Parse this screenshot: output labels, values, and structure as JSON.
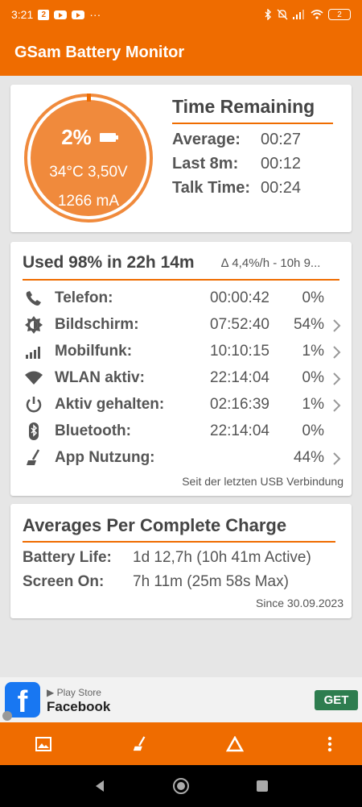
{
  "status_bar": {
    "time": "3:21",
    "notif_badge": "2",
    "more": "···",
    "battery": "2"
  },
  "app": {
    "title": "GSam Battery Monitor"
  },
  "gauge": {
    "percent": "2%",
    "temp_volt": "34°C  3,50V",
    "current": "1266 mA",
    "level": 0.02
  },
  "time_remaining": {
    "title": "Time Remaining",
    "rows": [
      {
        "label": "Average:",
        "value": "00:27"
      },
      {
        "label": "Last 8m:",
        "value": "00:12"
      },
      {
        "label": "Talk Time:",
        "value": "00:24"
      }
    ]
  },
  "usage": {
    "title": "Used 98% in 22h 14m",
    "rate": "∆ 4,4%/h - 10h 9...",
    "rows": [
      {
        "label": "Telefon:",
        "time": "00:00:42",
        "pct": "0%",
        "icon": "phone-icon"
      },
      {
        "label": "Bildschirm:",
        "time": "07:52:40",
        "pct": "54%",
        "icon": "brightness-icon"
      },
      {
        "label": "Mobilfunk:",
        "time": "10:10:15",
        "pct": "1%",
        "icon": "signal-icon"
      },
      {
        "label": "WLAN aktiv:",
        "time": "22:14:04",
        "pct": "0%",
        "icon": "wifi-icon"
      },
      {
        "label": "Aktiv gehalten:",
        "time": "02:16:39",
        "pct": "1%",
        "icon": "power-icon"
      },
      {
        "label": "Bluetooth:",
        "time": "22:14:04",
        "pct": "0%",
        "icon": "bluetooth-icon"
      },
      {
        "label": "App Nutzung:",
        "time": "",
        "pct": "44%",
        "icon": "broom-icon"
      }
    ],
    "footer": "Seit der letzten USB Verbindung"
  },
  "averages": {
    "title": "Averages Per Complete Charge",
    "rows": [
      {
        "label": "Battery Life:",
        "value": "1d 12,7h (10h 41m Active)"
      },
      {
        "label": "Screen On:",
        "value": "7h 11m (25m 58s Max)"
      }
    ],
    "footer": "Since 30.09.2023"
  },
  "ad": {
    "store": "Play Store",
    "name": "Facebook",
    "cta": "GET",
    "logo_letter": "f"
  },
  "colors": {
    "accent": "#ef6c00",
    "gauge_fill": "#f08a3c",
    "cta_green": "#2e7d4f",
    "fb_blue": "#1877f2"
  }
}
